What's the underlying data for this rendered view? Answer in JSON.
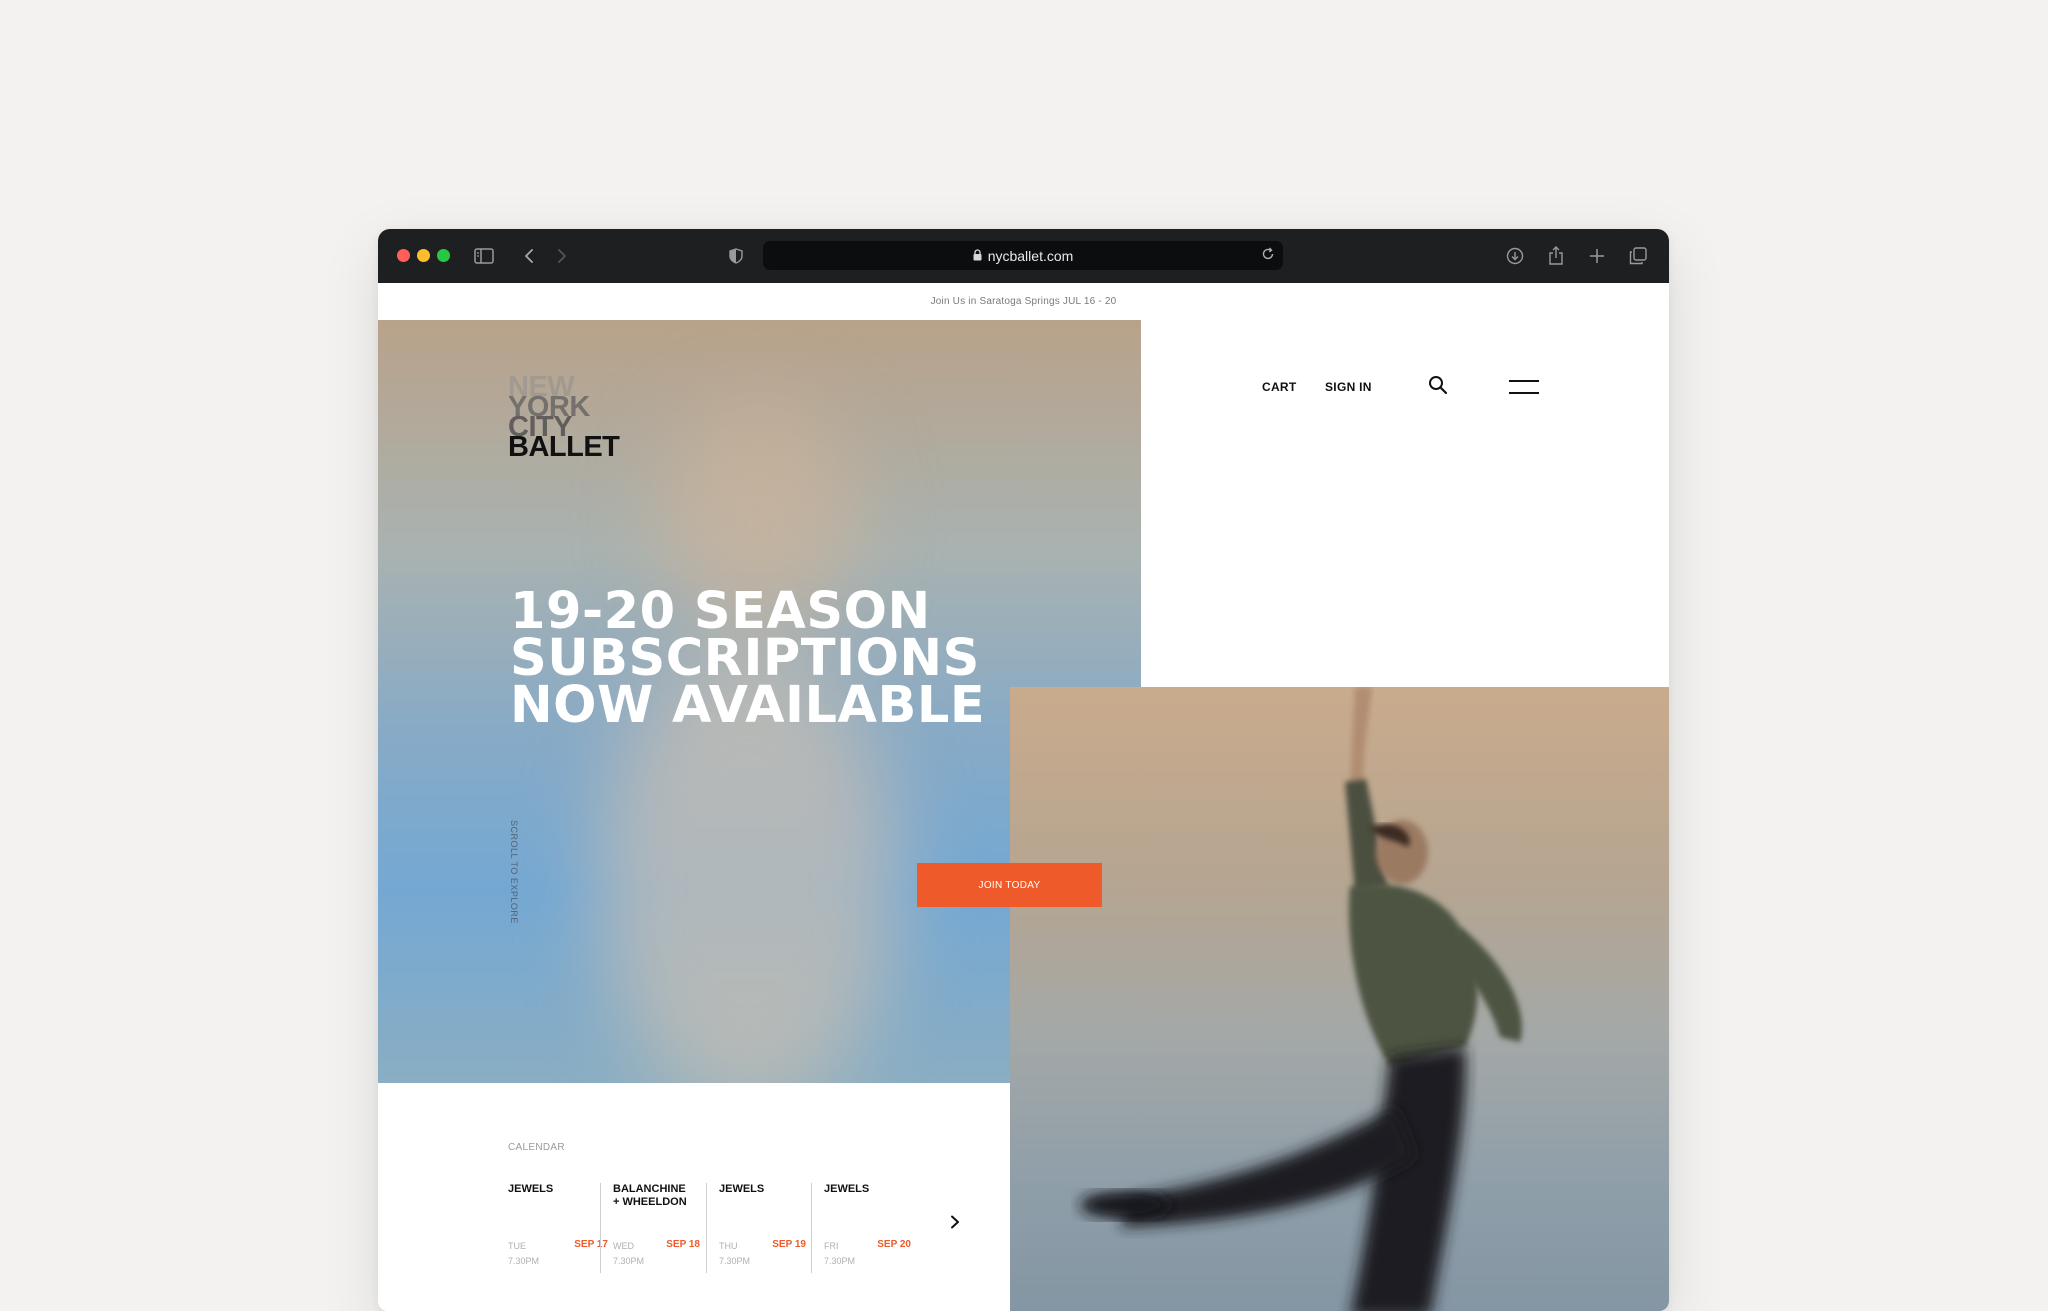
{
  "browser": {
    "url": "nycballet.com"
  },
  "announcement": "Join Us in Saratoga Springs JUL 16 - 20",
  "logo": [
    "NEW",
    "YORK",
    "CITY",
    "BALLET"
  ],
  "nav": {
    "cart": "CART",
    "sign_in": "SIGN IN"
  },
  "hero": {
    "headline": [
      "19-20 SEASON",
      "SUBSCRIPTIONS",
      "NOW AVAILABLE"
    ],
    "scroll_text": "SCROLL TO EXPLORE",
    "cta": "JOIN TODAY"
  },
  "calendar": {
    "label": "CALENDAR",
    "items": [
      {
        "title": "JEWELS",
        "day": "TUE",
        "time": "7.30PM",
        "date": "SEP 17"
      },
      {
        "title": "BALANCHINE\n+ WHEELDON",
        "day": "WED",
        "time": "7.30PM",
        "date": "SEP 18"
      },
      {
        "title": "JEWELS",
        "day": "THU",
        "time": "7.30PM",
        "date": "SEP 19"
      },
      {
        "title": "JEWELS",
        "day": "FRI",
        "time": "7.30PM",
        "date": "SEP 20"
      }
    ]
  },
  "colors": {
    "accent": "#ef5a2a",
    "toolbar": "#1d1f21"
  }
}
